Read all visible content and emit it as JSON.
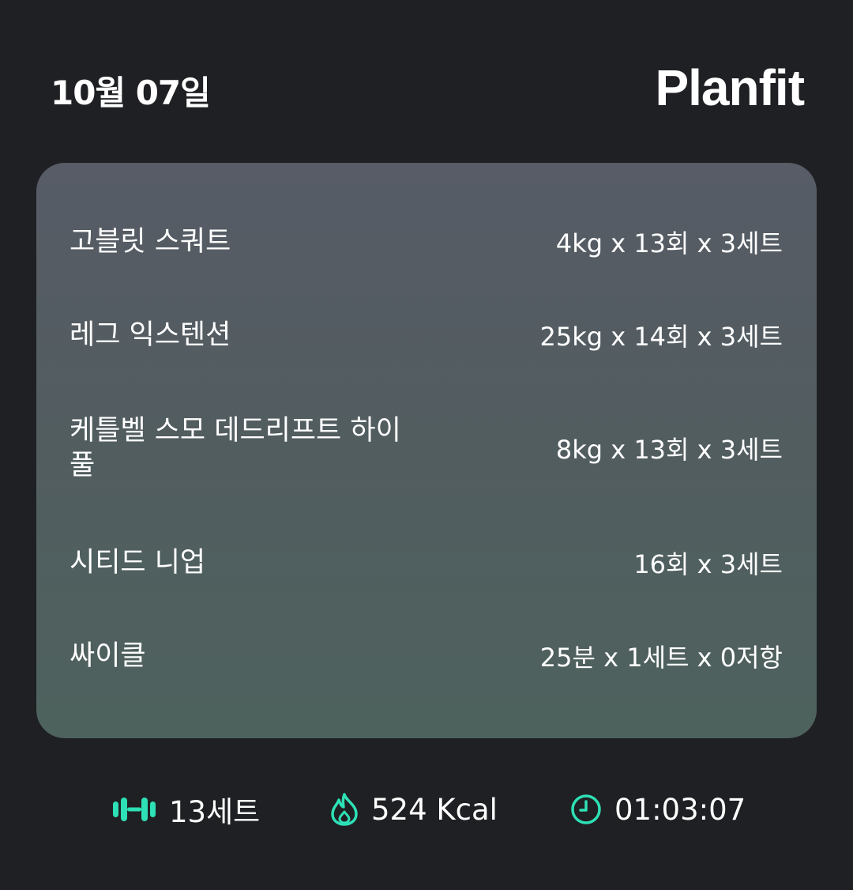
{
  "header": {
    "date": "10월 07일",
    "logo": "Planfit"
  },
  "exercises": [
    {
      "name": "고블릿 스쿼트",
      "detail": "4kg x 13회 x 3세트"
    },
    {
      "name": "레그 익스텐션",
      "detail": "25kg x 14회 x 3세트"
    },
    {
      "name": "케틀벨 스모 데드리프트 하이풀",
      "detail": "8kg x 13회 x 3세트"
    },
    {
      "name": "시티드 니업",
      "detail": "16회 x 3세트"
    },
    {
      "name": "싸이클",
      "detail": "25분 x 1세트 x 0저항"
    }
  ],
  "summary": {
    "sets": "13세트",
    "calories": "524 Kcal",
    "duration": "01:03:07",
    "icons": {
      "sets": "dumbbell-icon",
      "calories": "flame-icon",
      "duration": "clock-icon"
    },
    "accent_color": "#2ee0b6"
  }
}
